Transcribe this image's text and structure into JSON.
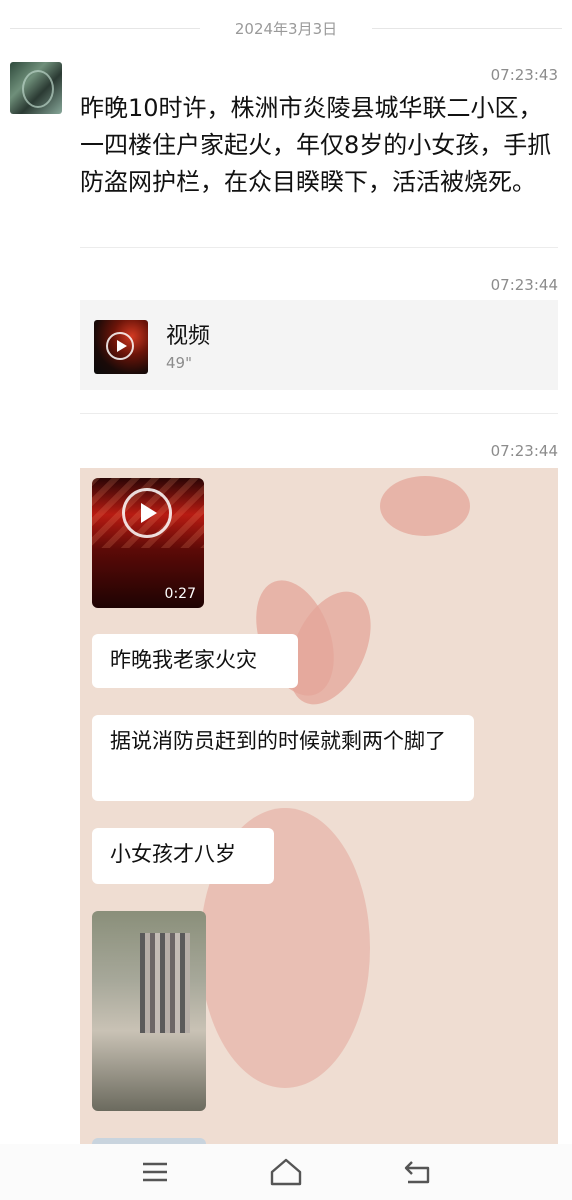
{
  "date_separator": "2024年3月3日",
  "messages": [
    {
      "time": "07:23:43",
      "text": "昨晚10时许，株洲市炎陵县城华联二小区，一四楼住户家起火，年仅8岁的小女孩，手抓防盗网护栏，在众目睽睽下，活活被烧死。"
    },
    {
      "time": "07:23:44",
      "video": {
        "title": "视频",
        "duration": "49\""
      }
    },
    {
      "time": "07:23:44",
      "screenshot": {
        "video_duration": "0:27",
        "bubbles": [
          "昨晚我老家火灾",
          "据说消防员赶到的时候就剩两个脚了",
          "小女孩才八岁"
        ]
      }
    }
  ],
  "colors": {
    "accent_bg": "#efddd2",
    "heart": "#e4a59a"
  },
  "icons": [
    "menu-icon",
    "home-icon",
    "back-icon",
    "play-icon"
  ]
}
